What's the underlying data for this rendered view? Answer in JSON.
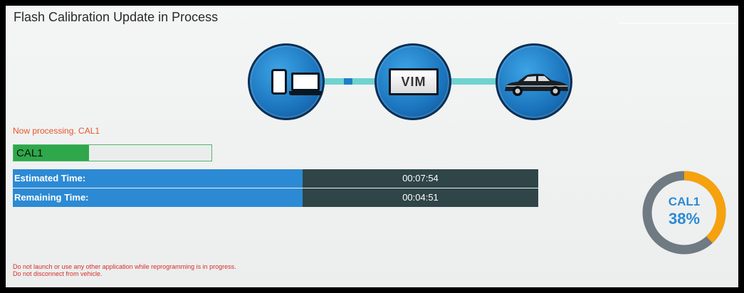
{
  "window": {
    "title": "Flash Calibration Update in Process"
  },
  "diagram": {
    "nodes": [
      {
        "icon": "tablet-laptop-icon"
      },
      {
        "label": "VIM"
      },
      {
        "icon": "car-icon"
      }
    ]
  },
  "status": {
    "message": "Now processing. CAL1",
    "progress_label": "CAL1",
    "progress_fraction": 0.38
  },
  "timing": {
    "estimated_label": "Estimated Time:",
    "estimated_value": "00:07:54",
    "remaining_label": "Remaining Time:",
    "remaining_value": "00:04:51"
  },
  "ring": {
    "name": "CAL1",
    "percent_text": "38%",
    "fraction": 0.38
  },
  "warnings": {
    "line1": "Do not launch or use any other application while reprogramming is in progress.",
    "line2": "Do not disconnect from vehicle."
  },
  "colors": {
    "accent_blue": "#2c8ad4",
    "progress_green": "#2ea84a",
    "ring_orange": "#f5a20e",
    "ring_gray": "#6f7a82",
    "warning_red": "#d4302a"
  }
}
